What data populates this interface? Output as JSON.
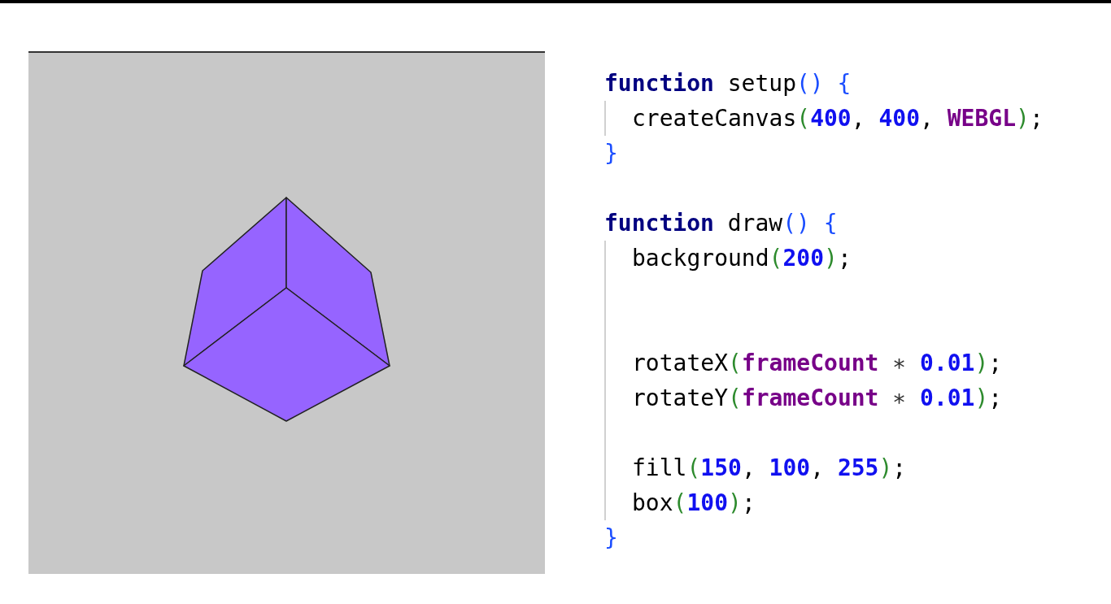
{
  "sketch": {
    "kind": "cube"
  },
  "code": {
    "blocks": [
      {
        "header": [
          {
            "text": "function",
            "kind": "keyword"
          },
          {
            "text": " setup",
            "kind": "plain"
          },
          {
            "text": "() {",
            "kind": "brace"
          }
        ],
        "body": [
          {
            "kind": "code",
            "tokens": [
              {
                "text": "createCanvas",
                "kind": "plain"
              },
              {
                "text": "(",
                "kind": "paren"
              },
              {
                "text": "400",
                "kind": "number"
              },
              {
                "text": ", ",
                "kind": "plain"
              },
              {
                "text": "400",
                "kind": "number"
              },
              {
                "text": ", ",
                "kind": "plain"
              },
              {
                "text": "WEBGL",
                "kind": "constant"
              },
              {
                "text": ")",
                "kind": "paren"
              },
              {
                "text": ";",
                "kind": "plain"
              }
            ]
          }
        ],
        "footer": [
          {
            "text": "}",
            "kind": "brace"
          }
        ]
      },
      {
        "header": [
          {
            "text": "function",
            "kind": "keyword"
          },
          {
            "text": " draw",
            "kind": "plain"
          },
          {
            "text": "() {",
            "kind": "brace"
          }
        ],
        "body": [
          {
            "kind": "code",
            "tokens": [
              {
                "text": "background",
                "kind": "plain"
              },
              {
                "text": "(",
                "kind": "paren"
              },
              {
                "text": "200",
                "kind": "number"
              },
              {
                "text": ")",
                "kind": "paren"
              },
              {
                "text": ";",
                "kind": "plain"
              }
            ]
          },
          {
            "kind": "blank"
          },
          {
            "kind": "blank"
          },
          {
            "kind": "code",
            "tokens": [
              {
                "text": "rotateX",
                "kind": "plain"
              },
              {
                "text": "(",
                "kind": "paren"
              },
              {
                "text": "frameCount",
                "kind": "constant"
              },
              {
                "text": " ∗ ",
                "kind": "operator"
              },
              {
                "text": "0.01",
                "kind": "number"
              },
              {
                "text": ")",
                "kind": "paren"
              },
              {
                "text": ";",
                "kind": "plain"
              }
            ]
          },
          {
            "kind": "code",
            "tokens": [
              {
                "text": "rotateY",
                "kind": "plain"
              },
              {
                "text": "(",
                "kind": "paren"
              },
              {
                "text": "frameCount",
                "kind": "constant"
              },
              {
                "text": " ∗ ",
                "kind": "operator"
              },
              {
                "text": "0.01",
                "kind": "number"
              },
              {
                "text": ")",
                "kind": "paren"
              },
              {
                "text": ";",
                "kind": "plain"
              }
            ]
          },
          {
            "kind": "blank"
          },
          {
            "kind": "code",
            "tokens": [
              {
                "text": "fill",
                "kind": "plain"
              },
              {
                "text": "(",
                "kind": "paren"
              },
              {
                "text": "150",
                "kind": "number"
              },
              {
                "text": ", ",
                "kind": "plain"
              },
              {
                "text": "100",
                "kind": "number"
              },
              {
                "text": ", ",
                "kind": "plain"
              },
              {
                "text": "255",
                "kind": "number"
              },
              {
                "text": ")",
                "kind": "paren"
              },
              {
                "text": ";",
                "kind": "plain"
              }
            ]
          },
          {
            "kind": "code",
            "tokens": [
              {
                "text": "box",
                "kind": "plain"
              },
              {
                "text": "(",
                "kind": "paren"
              },
              {
                "text": "100",
                "kind": "number"
              },
              {
                "text": ")",
                "kind": "paren"
              },
              {
                "text": ";",
                "kind": "plain"
              }
            ]
          }
        ],
        "footer": [
          {
            "text": "}",
            "kind": "brace"
          }
        ]
      }
    ]
  }
}
